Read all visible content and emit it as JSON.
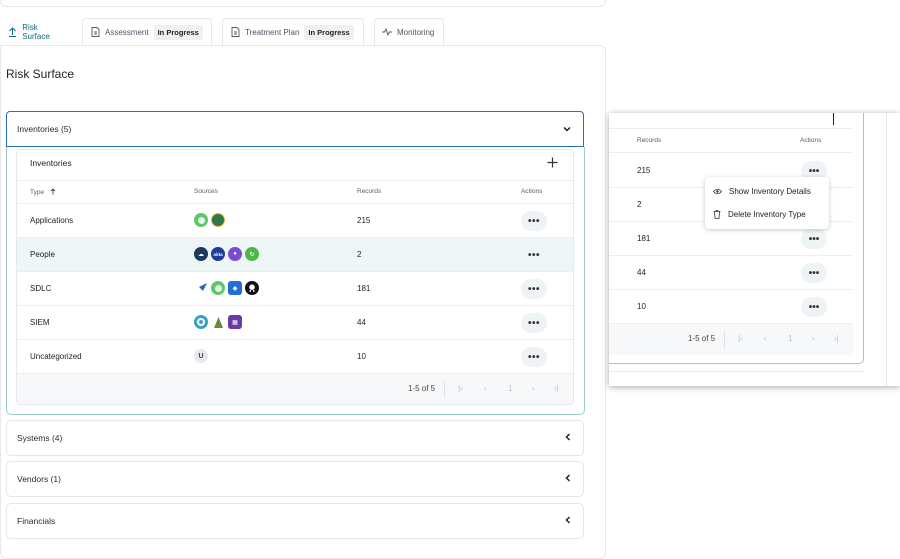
{
  "tabs": [
    {
      "label": "Risk Surface",
      "badge": ""
    },
    {
      "label": "Assessment",
      "badge": "In Progress"
    },
    {
      "label": "Treatment Plan",
      "badge": "In Progress"
    },
    {
      "label": "Monitoring",
      "badge": ""
    }
  ],
  "page": {
    "title": "Risk Surface"
  },
  "accordions": [
    {
      "label": "Inventories (5)"
    },
    {
      "label": "Systems (4)"
    },
    {
      "label": "Vendors (1)"
    },
    {
      "label": "Financials"
    }
  ],
  "inventories": {
    "title": "Inventories",
    "columns": {
      "type": "Type",
      "sources": "Sources",
      "records": "Records",
      "actions": "Actions"
    },
    "rows": [
      {
        "type": "Applications",
        "records": "215",
        "sources": [
          "green-circle-icon",
          "tiger-badge-icon"
        ]
      },
      {
        "type": "People",
        "records": "2",
        "sources": [
          "cloud-icon",
          "okta-icon",
          "user-icon",
          "sync-icon"
        ]
      },
      {
        "type": "SDLC",
        "records": "181",
        "sources": [
          "pipelines-icon",
          "green-circle-icon",
          "shield-icon",
          "github-icon"
        ]
      },
      {
        "type": "SIEM",
        "records": "44",
        "sources": [
          "target-icon",
          "stack-icon",
          "grid-icon"
        ]
      },
      {
        "type": "Uncategorized",
        "records": "10",
        "sources": [
          "letter-u-icon"
        ],
        "source_letter": "U"
      }
    ],
    "pagination": {
      "range": "1-5 of 5",
      "page": "1"
    },
    "dots": "•••"
  },
  "zoom": {
    "records_header": "Records",
    "actions_header": "Actions",
    "rows": [
      "215",
      "2",
      "181",
      "44",
      "10"
    ],
    "pagination": {
      "range": "1-5 of 5",
      "page": "1"
    },
    "menu": {
      "show": "Show Inventory Details",
      "delete": "Delete Inventory Type"
    }
  },
  "colors": {
    "accent": "#0d6b7a",
    "open_border": "#2a6fb0"
  }
}
